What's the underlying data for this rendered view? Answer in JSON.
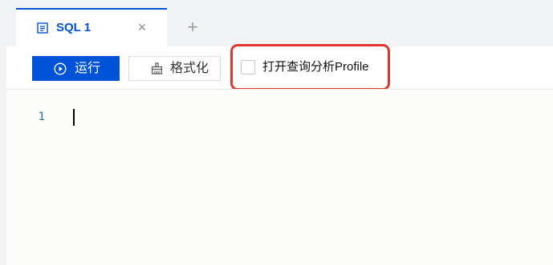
{
  "tabs": [
    {
      "label": "SQL 1",
      "icon": "document-icon",
      "active": true,
      "close_glyph": "×"
    }
  ],
  "add_tab_glyph": "+",
  "toolbar": {
    "run": {
      "label": "运行",
      "icon": "play-circle-icon"
    },
    "format": {
      "label": "格式化",
      "icon": "broom-icon"
    },
    "profile_checkbox": {
      "label": "打开查询分析Profile",
      "checked": false
    }
  },
  "editor": {
    "lines": [
      {
        "number": "1",
        "text": ""
      }
    ]
  },
  "colors": {
    "accent": "#0052d9",
    "highlight": "#e0362c",
    "line_number": "#237893"
  }
}
